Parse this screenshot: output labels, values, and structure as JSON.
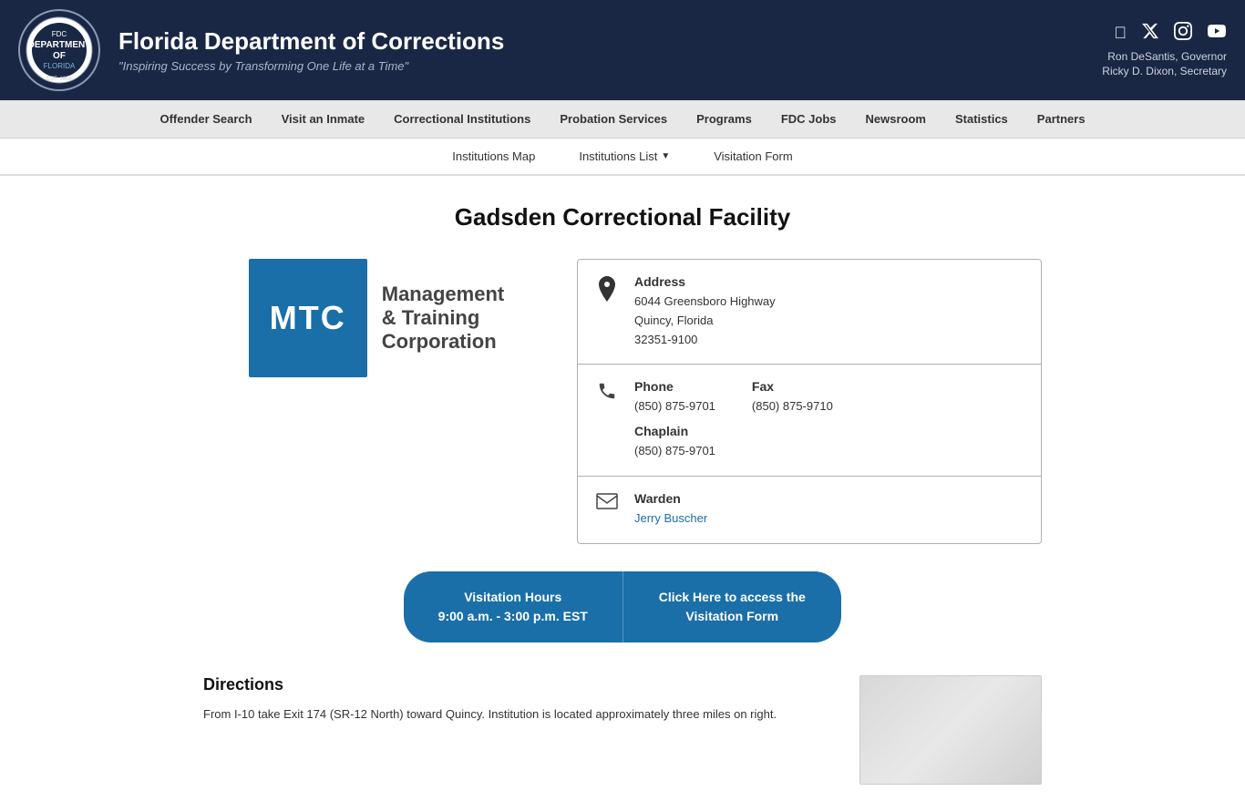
{
  "header": {
    "title": "Florida Department of Corrections",
    "subtitle": "\"Inspiring Success by Transforming One Life at a Time\"",
    "governor": "Ron DeSantis, Governor",
    "secretary": "Ricky D. Dixon, Secretary",
    "social": {
      "facebook": "f",
      "twitter": "𝕏",
      "instagram": "📷",
      "youtube": "▶"
    }
  },
  "primary_nav": {
    "items": [
      {
        "label": "Offender Search",
        "href": "#"
      },
      {
        "label": "Visit an Inmate",
        "href": "#"
      },
      {
        "label": "Correctional Institutions",
        "href": "#"
      },
      {
        "label": "Probation Services",
        "href": "#"
      },
      {
        "label": "Programs",
        "href": "#"
      },
      {
        "label": "FDC Jobs",
        "href": "#"
      },
      {
        "label": "Newsroom",
        "href": "#"
      },
      {
        "label": "Statistics",
        "href": "#"
      },
      {
        "label": "Partners",
        "href": "#"
      }
    ]
  },
  "secondary_nav": {
    "items": [
      {
        "label": "Institutions Map",
        "href": "#",
        "dropdown": false
      },
      {
        "label": "Institutions List",
        "href": "#",
        "dropdown": true
      },
      {
        "label": "Visitation Form",
        "href": "#",
        "dropdown": false
      }
    ]
  },
  "facility": {
    "title": "Gadsden Correctional Facility",
    "operator_logo_text": "MTC",
    "operator_name_line1": "Management",
    "operator_name_line2": "& Training",
    "operator_name_line3": "Corporation"
  },
  "address_card": {
    "title": "Address",
    "line1": "6044 Greensboro Highway",
    "line2": "Quincy, Florida",
    "line3": "32351-9100"
  },
  "contact_card": {
    "phone_label": "Phone",
    "phone": "(850) 875-9701",
    "fax_label": "Fax",
    "fax": "(850) 875-9710",
    "chaplain_label": "Chaplain",
    "chaplain_phone": "(850) 875-9701"
  },
  "warden_card": {
    "title": "Warden",
    "name": "Jerry Buscher"
  },
  "visitation_bar": {
    "left_line1": "Visitation Hours",
    "left_line2": "9:00 a.m. - 3:00 p.m. EST",
    "right_line1": "Click Here to access the",
    "right_line2": "Visitation Form"
  },
  "directions": {
    "heading": "Directions",
    "body": "From I-10 take Exit 174 (SR-12 North) toward Quincy. Institution is located approximately three miles on right."
  }
}
